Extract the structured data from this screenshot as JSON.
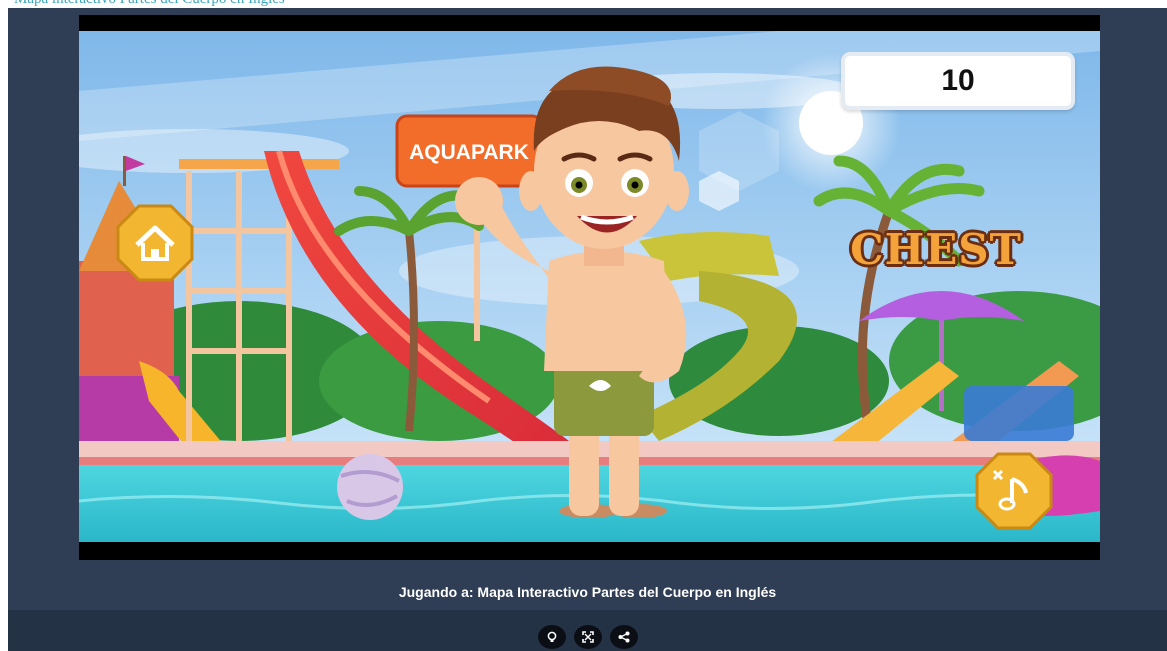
{
  "header": {
    "text": "Mapa interactivo Partes del Cuerpo en Inglés"
  },
  "game": {
    "score": "10",
    "target_word": "CHEST",
    "park_sign": "AQUAPARK",
    "home_button_icon": "home-icon",
    "mute_button_icon": "music-mute-icon"
  },
  "footer": {
    "caption": "Jugando a: Mapa Interactivo Partes del Cuerpo en Inglés",
    "buttons": [
      {
        "icon": "lightbulb-icon"
      },
      {
        "icon": "fullscreen-icon"
      },
      {
        "icon": "share-icon"
      }
    ]
  },
  "colors": {
    "frame_bg": "#2f3e55",
    "toolbar_bg": "#243245",
    "word_fill": "#f4a23a",
    "word_outline": "#6b2e12",
    "button_gold": "#f2b630"
  }
}
